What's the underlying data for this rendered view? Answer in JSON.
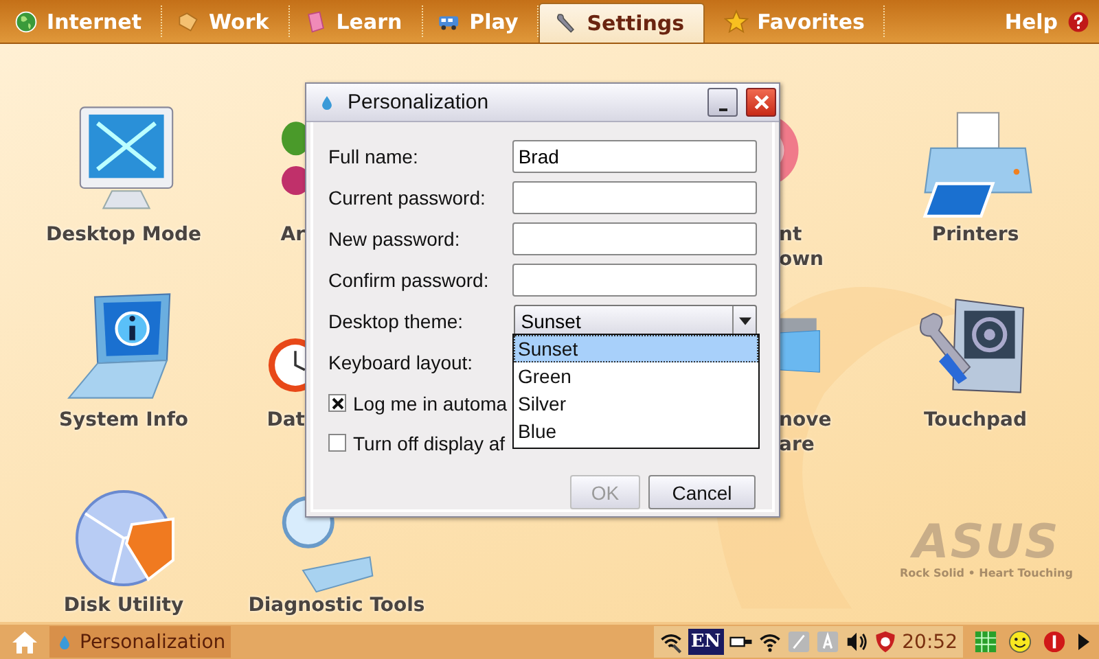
{
  "tabs": [
    {
      "label": "Internet",
      "kind": "globe",
      "selected": false
    },
    {
      "label": "Work",
      "kind": "folder",
      "selected": false
    },
    {
      "label": "Learn",
      "kind": "book",
      "selected": false
    },
    {
      "label": "Play",
      "kind": "bus",
      "selected": false
    },
    {
      "label": "Settings",
      "kind": "wrench",
      "selected": true
    },
    {
      "label": "Favorites",
      "kind": "star",
      "selected": false
    }
  ],
  "help": {
    "label": "Help"
  },
  "desktop": [
    {
      "kind": "monitor",
      "lines": [
        "Desktop Mode"
      ]
    },
    {
      "kind": "bug",
      "lines": [
        "Ar"
      ]
    },
    {
      "kind": "pink",
      "lines": [
        "nt",
        "own"
      ]
    },
    {
      "kind": "printer",
      "lines": [
        "Printers"
      ]
    },
    {
      "kind": "laptop",
      "lines": [
        "System Info"
      ]
    },
    {
      "kind": "clock",
      "lines": [
        "Dat"
      ]
    },
    {
      "kind": "folder",
      "lines": [
        "nove",
        "are"
      ]
    },
    {
      "kind": "touchpad",
      "lines": [
        "Touchpad"
      ]
    },
    {
      "kind": "disk",
      "lines": [
        "Disk Utility"
      ]
    },
    {
      "kind": "diagnostic",
      "lines": [
        "Diagnostic Tools"
      ]
    }
  ],
  "dialog": {
    "title": "Personalization",
    "fields": [
      {
        "label": "Full name:",
        "kind": "text",
        "value": "Brad"
      },
      {
        "label": "Current password:",
        "kind": "text"
      },
      {
        "label": "New password:",
        "kind": "text"
      },
      {
        "label": "Confirm password:",
        "kind": "text"
      },
      {
        "label": "Desktop theme:",
        "kind": "combo",
        "value": "Sunset"
      },
      {
        "label": "Keyboard layout:",
        "kind": "hidden"
      }
    ],
    "checks": [
      {
        "label": "Log me in automa",
        "checked": true
      },
      {
        "label": "Turn off display af",
        "checked": false
      }
    ],
    "dropdown": [
      {
        "label": "Sunset",
        "selected": true
      },
      {
        "label": "Green",
        "selected": false
      },
      {
        "label": "Silver",
        "selected": false
      },
      {
        "label": "Blue",
        "selected": false
      }
    ],
    "buttons": [
      {
        "label": "OK",
        "disabled": true
      },
      {
        "label": "Cancel",
        "disabled": false
      }
    ]
  },
  "wallpaper": {
    "logo": "ASUS",
    "slogan": "Rock Solid • Heart Touching"
  },
  "taskbar": {
    "task": "Personalization",
    "language": "EN",
    "time": "20:52"
  }
}
